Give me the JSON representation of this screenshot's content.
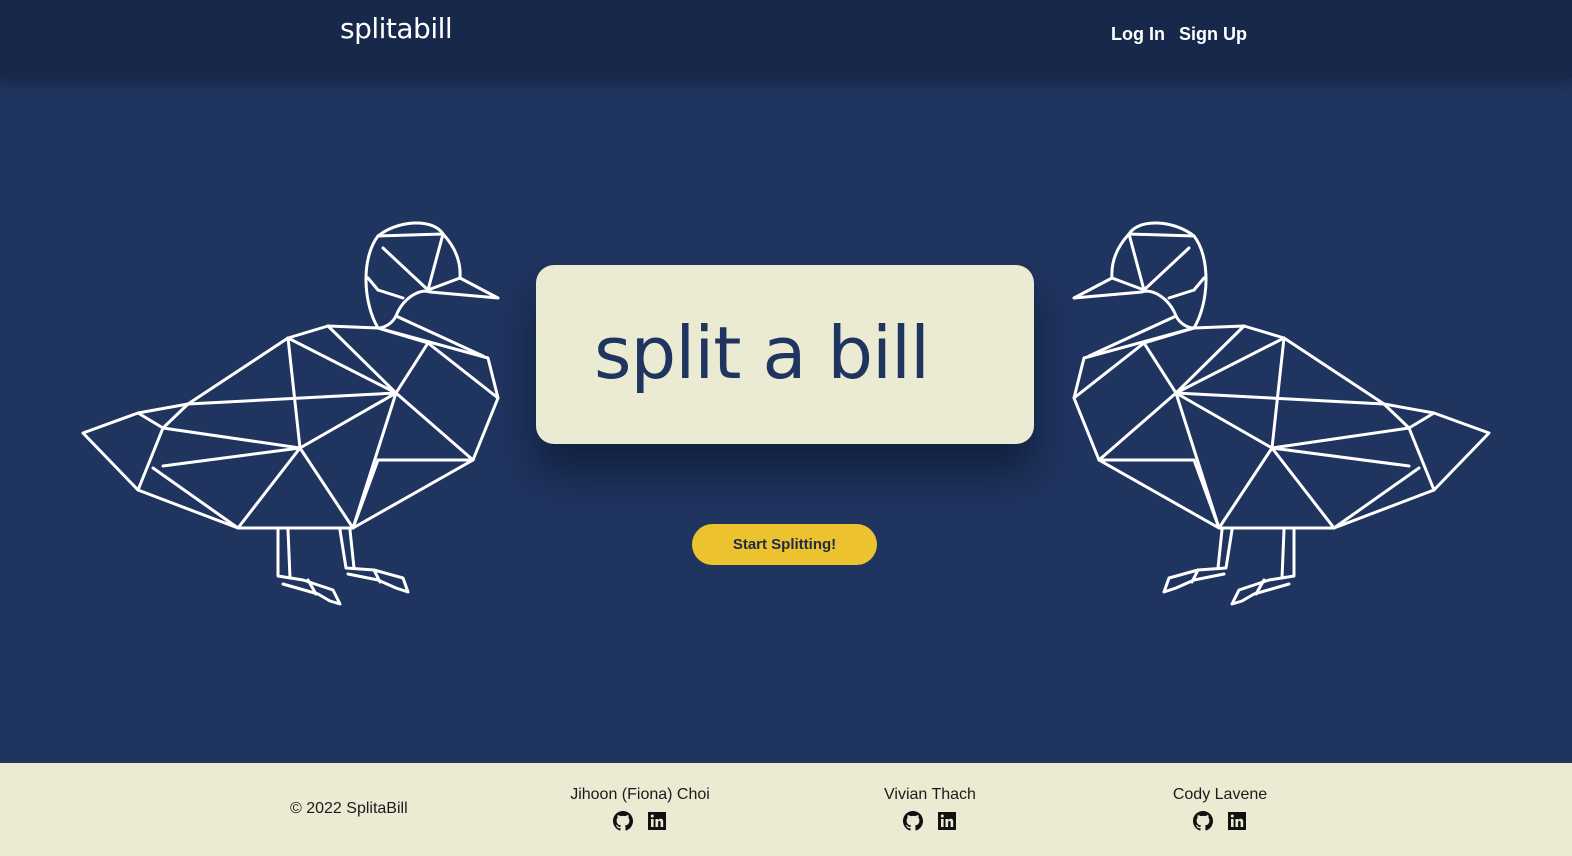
{
  "navbar": {
    "brand": "splitabill",
    "login_label": "Log In",
    "signup_label": "Sign Up"
  },
  "hero": {
    "title": "split a bill",
    "button_label": "Start Splitting!"
  },
  "footer": {
    "copyright": "© 2022 SplitaBill",
    "contributors": [
      {
        "name": "Jihoon (Fiona) Choi",
        "icons": [
          "github-icon",
          "linkedin-icon"
        ]
      },
      {
        "name": "Vivian Thach",
        "icons": [
          "github-icon",
          "linkedin-icon"
        ]
      },
      {
        "name": "Cody Lavene",
        "icons": [
          "github-icon",
          "linkedin-icon"
        ]
      }
    ]
  },
  "colors": {
    "navbar_bg": "#17284a",
    "page_bg": "#1f345f",
    "card_bg": "#ebebd3",
    "accent_button": "#ecc22f",
    "footer_bg": "#ebebd3"
  },
  "decorations": [
    "geometric-duck-left",
    "geometric-duck-right"
  ]
}
